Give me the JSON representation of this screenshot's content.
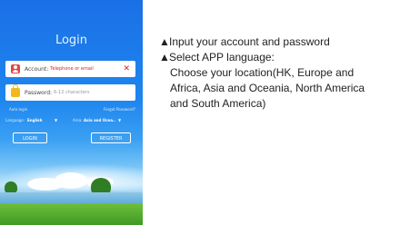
{
  "login_screen": {
    "title": "Login",
    "account_label": "Account:",
    "account_placeholder": "Telephone or email",
    "clear_symbol": "✕",
    "password_label": "Password:",
    "password_placeholder": "6-12 characters",
    "auto_login": "Auto login",
    "forgot_password": "Forgot Password?",
    "language_label": "Language:",
    "language_value": "English",
    "area_label": "Area:",
    "area_value": "Asia and Ocea..",
    "dropdown_symbol": "▼",
    "login_button": "LOGIN",
    "register_button": "REGISTER",
    "colors": {
      "accent_red": "#e02020",
      "lock_yellow": "#f2b81e",
      "sky_blue": "#1a70e6"
    }
  },
  "instructions": {
    "bullet": "▲",
    "line1": "Input your account and password",
    "line2": "Select APP language:",
    "line3": "Choose your location(HK, Europe and",
    "line4": "Africa, Asia and Oceania, North America",
    "line5": "and South America)"
  }
}
